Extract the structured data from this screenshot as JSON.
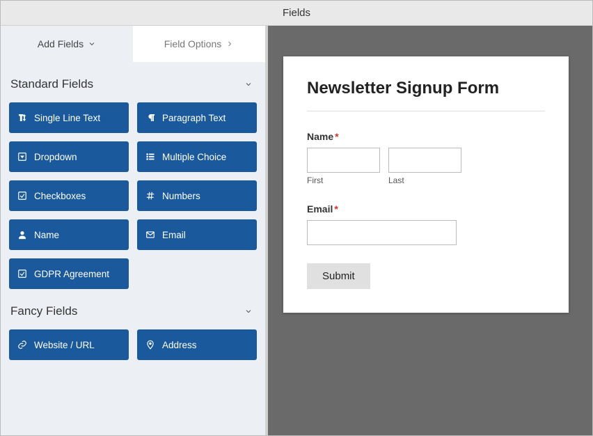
{
  "window": {
    "title": "Fields"
  },
  "tabs": {
    "add_fields": "Add Fields",
    "field_options": "Field Options"
  },
  "groups": {
    "standard": {
      "title": "Standard Fields",
      "items": [
        {
          "label": "Single Line Text",
          "icon": "text-height-icon"
        },
        {
          "label": "Paragraph Text",
          "icon": "paragraph-icon"
        },
        {
          "label": "Dropdown",
          "icon": "caret-square-icon"
        },
        {
          "label": "Multiple Choice",
          "icon": "list-ul-icon"
        },
        {
          "label": "Checkboxes",
          "icon": "check-square-icon"
        },
        {
          "label": "Numbers",
          "icon": "hash-icon"
        },
        {
          "label": "Name",
          "icon": "user-icon"
        },
        {
          "label": "Email",
          "icon": "envelope-icon"
        },
        {
          "label": "GDPR Agreement",
          "icon": "check-square-icon"
        }
      ]
    },
    "fancy": {
      "title": "Fancy Fields",
      "items": [
        {
          "label": "Website / URL",
          "icon": "link-icon"
        },
        {
          "label": "Address",
          "icon": "map-pin-icon"
        }
      ]
    }
  },
  "form": {
    "title": "Newsletter Signup Form",
    "name_label": "Name",
    "first_sub": "First",
    "last_sub": "Last",
    "email_label": "Email",
    "submit_label": "Submit"
  }
}
